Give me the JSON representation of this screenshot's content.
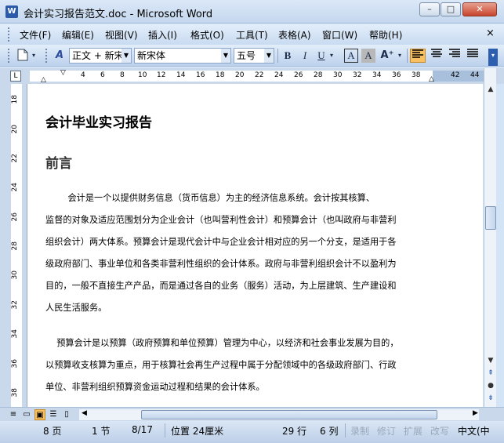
{
  "window": {
    "title": "会计实习报告范文.doc - Microsoft Word",
    "app_icon": "W",
    "minimize": "–",
    "maximize": "□",
    "close": "✕"
  },
  "menu": {
    "items": [
      "文件(F)",
      "编辑(E)",
      "视图(V)",
      "插入(I)",
      "格式(O)",
      "工具(T)",
      "表格(A)",
      "窗口(W)",
      "帮助(H)"
    ],
    "close_doc": "×"
  },
  "toolbar": {
    "style_value": "正文 + 新宋",
    "font_value": "新宋体",
    "size_value": "五号",
    "bold": "B",
    "italic": "I",
    "underline": "U",
    "char_border": "A",
    "char_shading": "A"
  },
  "ruler": {
    "corner": "L",
    "ticks": [
      "4",
      "6",
      "8",
      "10",
      "12",
      "14",
      "16",
      "18",
      "20",
      "22",
      "24",
      "26",
      "28",
      "30",
      "32",
      "34",
      "36",
      "38",
      "42",
      "44"
    ],
    "vticks": [
      "18",
      "20",
      "22",
      "24",
      "26",
      "28",
      "30",
      "32",
      "34",
      "36",
      "38"
    ]
  },
  "document": {
    "heading1": "会计毕业实习报告",
    "heading2": "前言",
    "para1": [
      "        会计是一个以提供财务信息（货币信息）为主的经济信息系统。会计按其核算、",
      "监督的对象及适应范围划分为企业会计（也叫营利性会计）和预算会计（也叫政府与非营利",
      "组织会计）两大体系。预算会计是现代会计中与企业会计相对应的另一个分支，是适用于各",
      "级政府部门、事业单位和各类非营利性组织的会计体系。政府与非营利组织会计不以盈利为",
      "目的，一般不直接生产产品，而是通过各自的业务（服务）活动，为上层建筑、生产建设和",
      "人民生活服务。"
    ],
    "para2": [
      "    预算会计是以预算（政府预算和单位预算）管理为中心，以经济和社会事业发展为目的，",
      "以预算收支核算为重点，用于核算社会再生产过程中属于分配领域中的各级政府部门、行政",
      "单位、非营利组织预算资金运动过程和结果的会计体系。"
    ]
  },
  "status": {
    "page": "8 页",
    "section": "1 节",
    "page_of": "8/17",
    "position": "位置 24厘米",
    "line": "29 行",
    "column": "6 列",
    "rec": "录制",
    "trk": "修订",
    "ext": "扩展",
    "ovr": "改写",
    "lang": "中文(中"
  }
}
